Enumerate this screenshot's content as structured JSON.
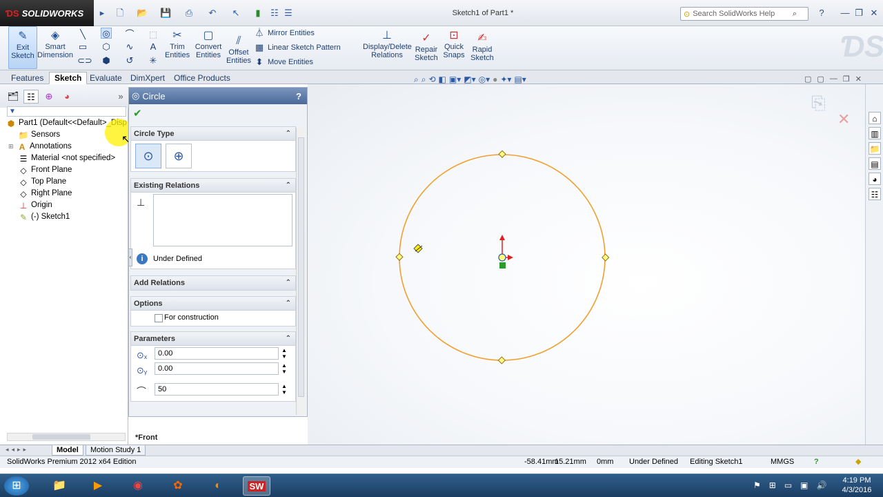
{
  "app": {
    "logo_text": "SOLIDWORKS",
    "doc_title": "Sketch1 of Part1 *",
    "help_placeholder": "Search SolidWorks Help"
  },
  "commands": {
    "exit_sketch": "Exit Sketch",
    "smart_dimension": "Smart Dimension",
    "trim_entities": "Trim Entities",
    "convert_entities": "Convert Entities",
    "offset_entities": "Offset Entities",
    "mirror_entities": "Mirror Entities",
    "linear_sketch_pattern": "Linear Sketch Pattern",
    "move_entities": "Move Entities",
    "display_delete_relations": "Display/Delete Relations",
    "repair_sketch": "Repair Sketch",
    "quick_snaps": "Quick Snaps",
    "rapid_sketch": "Rapid Sketch"
  },
  "tabs": [
    "Features",
    "Sketch",
    "Evaluate",
    "DimXpert",
    "Office Products"
  ],
  "active_tab": "Sketch",
  "tree": [
    {
      "label": "Part1  (Default<<Default>_Disp",
      "icon": "part-icon"
    },
    {
      "label": "Sensors",
      "icon": "sensors-folder-icon"
    },
    {
      "label": "Annotations",
      "icon": "annotations-icon"
    },
    {
      "label": "Material <not specified>",
      "icon": "material-icon"
    },
    {
      "label": "Front Plane",
      "icon": "plane-icon"
    },
    {
      "label": "Top Plane",
      "icon": "plane-icon"
    },
    {
      "label": "Right Plane",
      "icon": "plane-icon"
    },
    {
      "label": "Origin",
      "icon": "origin-icon"
    },
    {
      "label": "(-) Sketch1",
      "icon": "sketch-icon"
    }
  ],
  "property_manager": {
    "title": "Circle",
    "circle_type": "Circle Type",
    "existing_relations": "Existing Relations",
    "relation_status": "Under Defined",
    "add_relations": "Add Relations",
    "options": "Options",
    "for_construction": "For construction",
    "parameters": "Parameters",
    "center_x": "0.00",
    "center_y": "0.00",
    "radius": "50"
  },
  "view_label": "*Front",
  "bottom_tabs": [
    "Model",
    "Motion Study 1"
  ],
  "status": {
    "edition": "SolidWorks Premium 2012 x64 Edition",
    "x": "-58.41mm",
    "y": "15.21mm",
    "z": "0mm",
    "state": "Under Defined",
    "editing": "Editing Sketch1",
    "units": "MMGS"
  },
  "clock": {
    "time": "4:19 PM",
    "date": "4/3/2016"
  },
  "colors": {
    "sketch_circle": "#f0a030",
    "accent": "#4b6a99"
  }
}
